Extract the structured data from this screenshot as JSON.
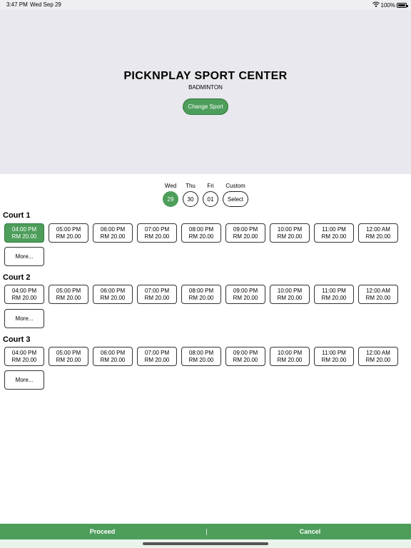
{
  "status_bar": {
    "time": "3:47 PM",
    "date": "Wed Sep 29",
    "battery": "100%",
    "wifi_icon": "wifi-icon",
    "battery_icon": "battery-icon"
  },
  "header": {
    "venue_name": "PICKNPLAY SPORT CENTER",
    "sport": "BADMINTON",
    "change_sport_label": "Change Sport"
  },
  "dates": [
    {
      "day": "Wed",
      "value": "29",
      "selected": true
    },
    {
      "day": "Thu",
      "value": "30",
      "selected": false
    },
    {
      "day": "Fri",
      "value": "01",
      "selected": false
    },
    {
      "day": "Custom",
      "value": "Select",
      "selected": false
    }
  ],
  "courts": [
    {
      "name": "Court 1",
      "more_label": "More...",
      "slots": [
        {
          "time": "04:00 PM",
          "price": "RM 20.00",
          "selected": true
        },
        {
          "time": "05:00 PM",
          "price": "RM 20.00",
          "selected": false
        },
        {
          "time": "06:00 PM",
          "price": "RM 20.00",
          "selected": false
        },
        {
          "time": "07:00 PM",
          "price": "RM 20.00",
          "selected": false
        },
        {
          "time": "08:00 PM",
          "price": "RM 20.00",
          "selected": false
        },
        {
          "time": "09:00 PM",
          "price": "RM 20.00",
          "selected": false
        },
        {
          "time": "10:00 PM",
          "price": "RM 20.00",
          "selected": false
        },
        {
          "time": "11:00 PM",
          "price": "RM 20.00",
          "selected": false
        },
        {
          "time": "12:00 AM",
          "price": "RM 20.00",
          "selected": false
        }
      ]
    },
    {
      "name": "Court 2",
      "more_label": "More...",
      "slots": [
        {
          "time": "04:00 PM",
          "price": "RM 20.00",
          "selected": false
        },
        {
          "time": "05:00 PM",
          "price": "RM 20.00",
          "selected": false
        },
        {
          "time": "06:00 PM",
          "price": "RM 20.00",
          "selected": false
        },
        {
          "time": "07:00 PM",
          "price": "RM 20.00",
          "selected": false
        },
        {
          "time": "08:00 PM",
          "price": "RM 20.00",
          "selected": false
        },
        {
          "time": "09:00 PM",
          "price": "RM 20.00",
          "selected": false
        },
        {
          "time": "10:00 PM",
          "price": "RM 20.00",
          "selected": false
        },
        {
          "time": "11:00 PM",
          "price": "RM 20.00",
          "selected": false
        },
        {
          "time": "12:00 AM",
          "price": "RM 20.00",
          "selected": false
        }
      ]
    },
    {
      "name": "Court 3",
      "more_label": "More...",
      "slots": [
        {
          "time": "04:00 PM",
          "price": "RM 20.00",
          "selected": false
        },
        {
          "time": "05:00 PM",
          "price": "RM 20.00",
          "selected": false
        },
        {
          "time": "06:00 PM",
          "price": "RM 20.00",
          "selected": false
        },
        {
          "time": "07:00 PM",
          "price": "RM 20.00",
          "selected": false
        },
        {
          "time": "08:00 PM",
          "price": "RM 20.00",
          "selected": false
        },
        {
          "time": "09:00 PM",
          "price": "RM 20.00",
          "selected": false
        },
        {
          "time": "10:00 PM",
          "price": "RM 20.00",
          "selected": false
        },
        {
          "time": "11:00 PM",
          "price": "RM 20.00",
          "selected": false
        },
        {
          "time": "12:00 AM",
          "price": "RM 20.00",
          "selected": false
        }
      ]
    }
  ],
  "footer": {
    "proceed_label": "Proceed",
    "cancel_label": "Cancel",
    "divider_label": "|"
  },
  "colors": {
    "accent": "#4d9e5b",
    "header_bg": "#e9e8ee"
  }
}
